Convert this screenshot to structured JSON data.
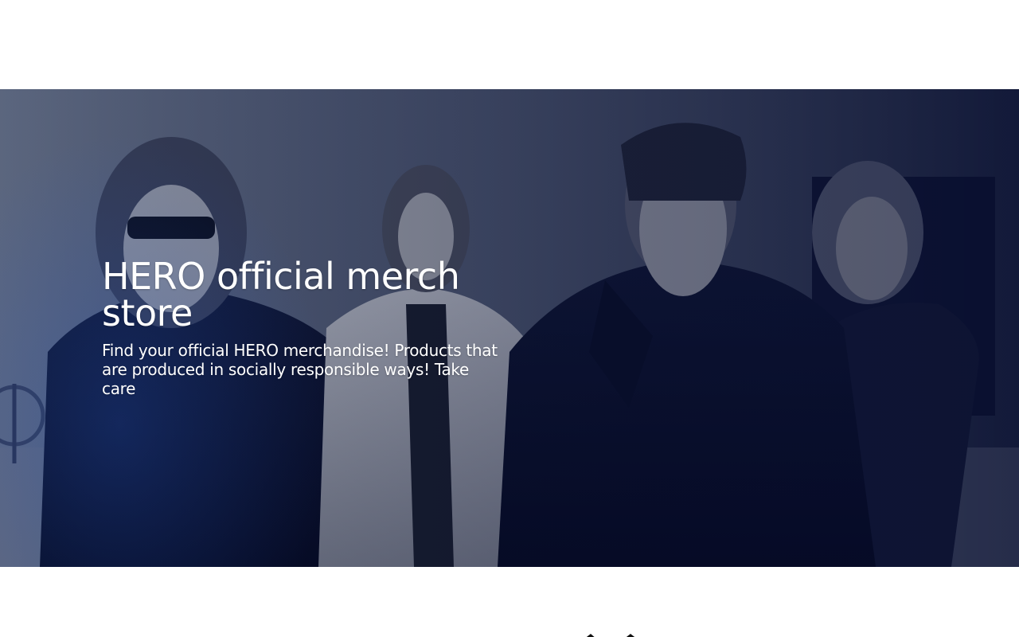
{
  "hero": {
    "title": "HERO official merch store",
    "subtitle": "Find your official HERO merchandise! Products that are produced in socially responsible ways! Take care",
    "image_icon": "band-photo",
    "overlay_color": "#0b1440"
  },
  "colors": {
    "background": "#ffffff",
    "text_on_hero": "#ffffff"
  }
}
